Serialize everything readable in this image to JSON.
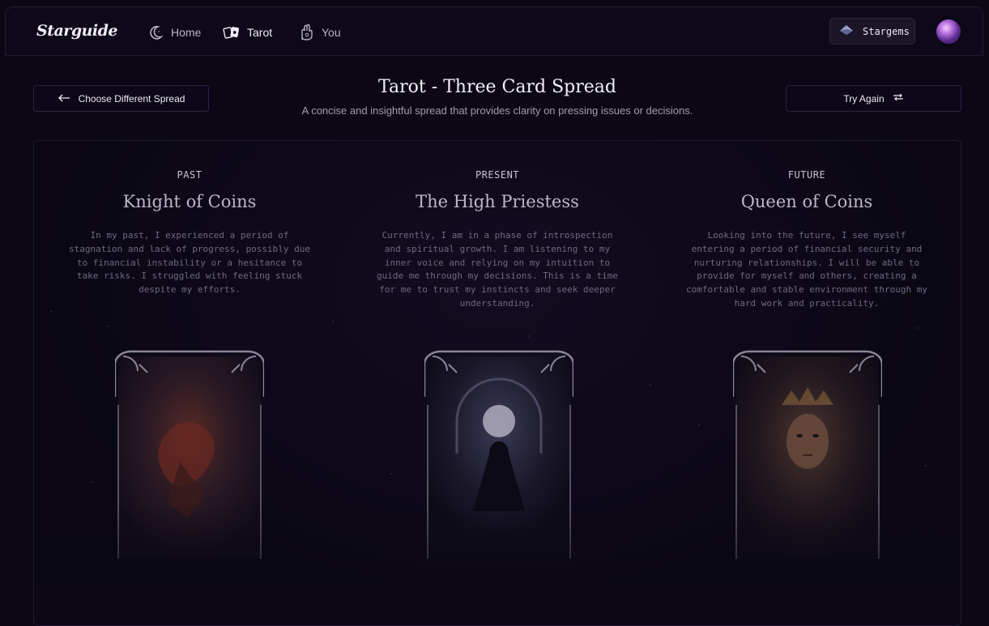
{
  "header": {
    "logo": "Starguide",
    "nav": [
      {
        "label": "Home",
        "icon": "moon-icon"
      },
      {
        "label": "Tarot",
        "icon": "tarot-cards-icon"
      },
      {
        "label": "You",
        "icon": "palm-icon"
      }
    ],
    "stargems_label": "Stargems",
    "stargems_icon": "gem-icon"
  },
  "page": {
    "back_label": "Choose Different Spread",
    "title": "Tarot - Three Card Spread",
    "subtitle": "A concise and insightful spread that provides clarity on pressing issues or decisions.",
    "retry_label": "Try Again"
  },
  "cards": [
    {
      "position": "PAST",
      "name": "Knight of Coins",
      "description": "In my past, I experienced a period of stagnation and lack of progress, possibly due to financial instability or a hesitance to take risks. I struggled with feeling stuck despite my efforts."
    },
    {
      "position": "PRESENT",
      "name": "The High Priestess",
      "description": "Currently, I am in a phase of introspection and spiritual growth. I am listening to my inner voice and relying on my intuition to guide me through my decisions. This is a time for me to trust my instincts and seek deeper understanding."
    },
    {
      "position": "FUTURE",
      "name": "Queen of Coins",
      "description": "Looking into the future, I see myself entering a period of financial security and nurturing relationships. I will be able to provide for myself and others, creating a comfortable and stable environment through my hard work and practicality."
    }
  ],
  "colors": {
    "background": "#0b0714",
    "accent": "#b36cd9"
  }
}
